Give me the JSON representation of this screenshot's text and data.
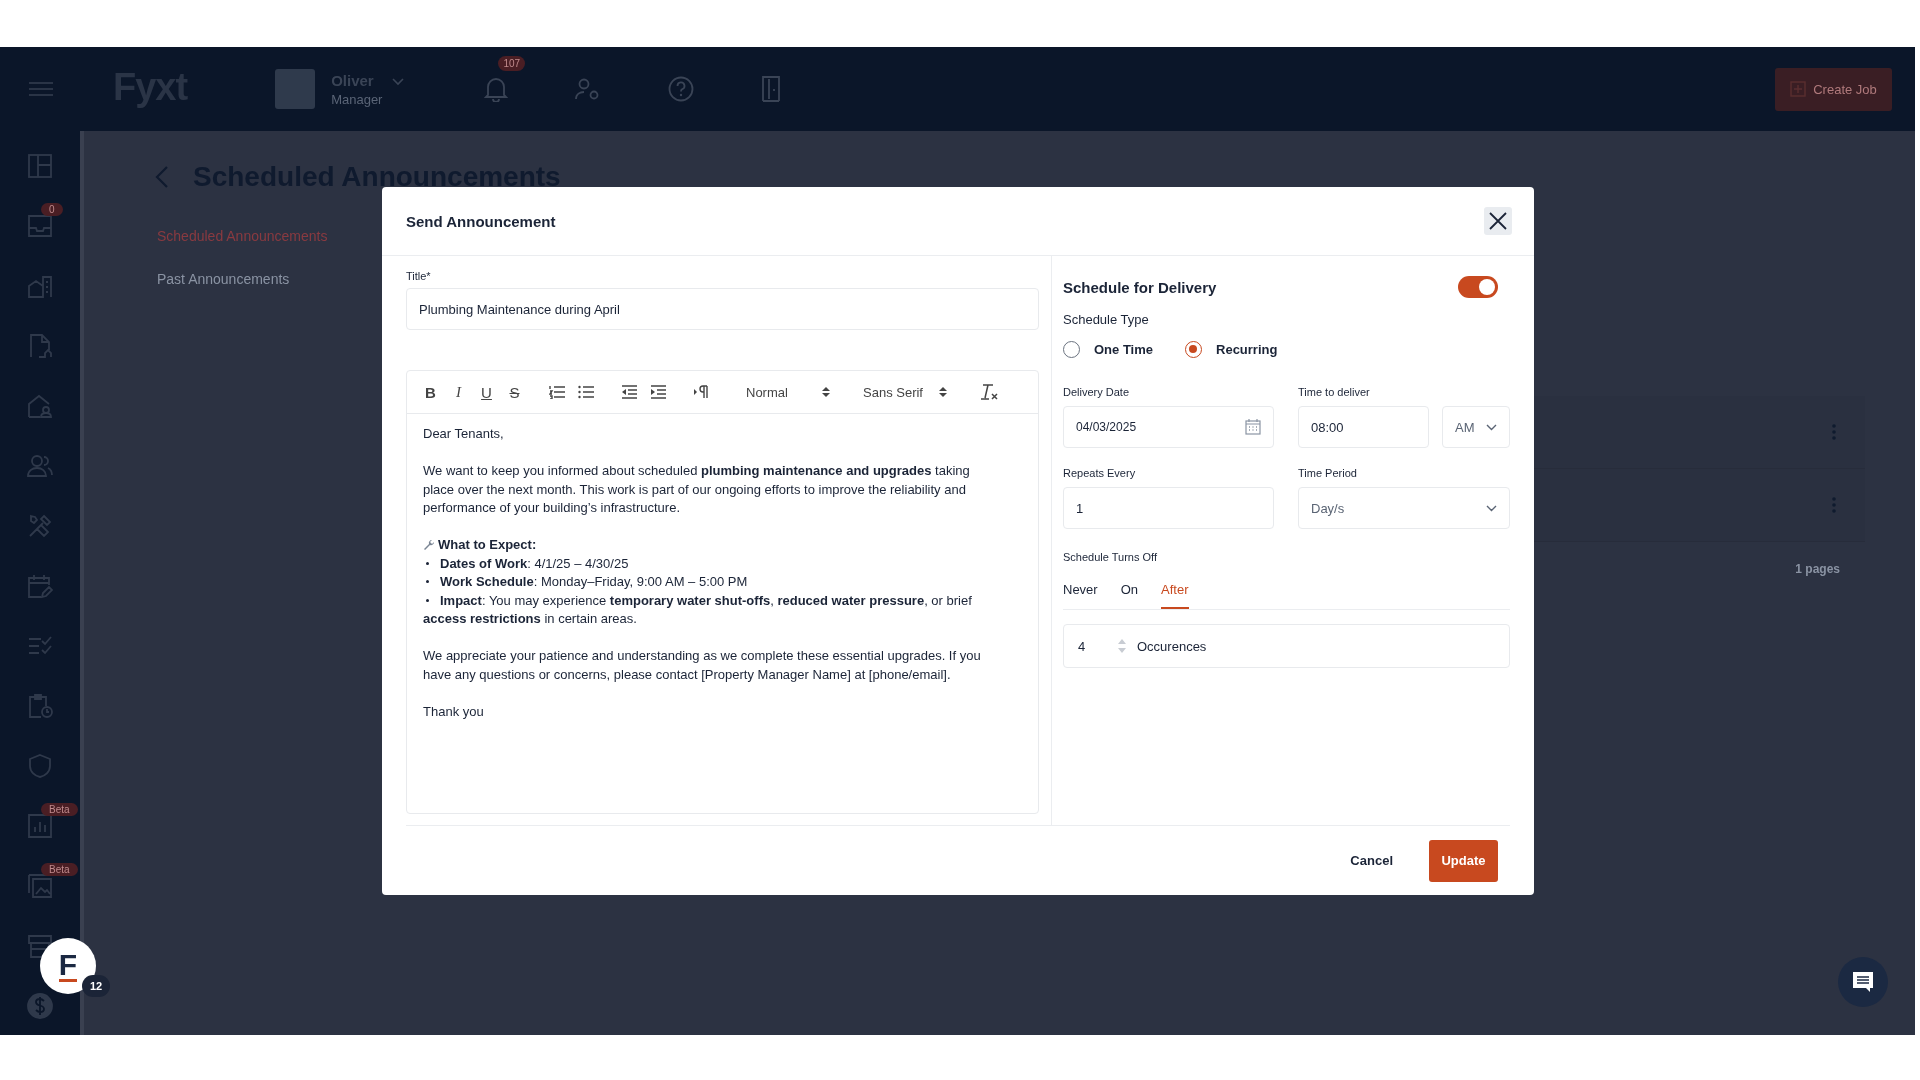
{
  "topbar": {
    "logo": "Fyxt",
    "user": {
      "name": "Oliver",
      "role": "Manager"
    },
    "notifications_badge": "107",
    "create_button": "Create Job"
  },
  "sidebar": {
    "items": [
      {
        "kind": "dashboard"
      },
      {
        "kind": "inbox",
        "badge": "0"
      },
      {
        "kind": "buildings"
      },
      {
        "kind": "document"
      },
      {
        "kind": "house"
      },
      {
        "kind": "people"
      },
      {
        "kind": "tools"
      },
      {
        "kind": "calendar"
      },
      {
        "kind": "checklist"
      },
      {
        "kind": "clipboard"
      },
      {
        "kind": "shield"
      },
      {
        "kind": "chart",
        "badge": "Beta"
      },
      {
        "kind": "gallery",
        "badge": "Beta"
      },
      {
        "kind": "store"
      },
      {
        "kind": "dollar"
      }
    ]
  },
  "assistant": {
    "letter": "F",
    "badge": "12"
  },
  "page": {
    "title": "Scheduled Announcements",
    "nav": [
      {
        "label": "Scheduled Announcements",
        "selected": true
      },
      {
        "label": "Past Announcements",
        "selected": false
      }
    ],
    "pagination": "1 pages"
  },
  "modal": {
    "title": "Send Announcement",
    "title_field": {
      "label": "Title*",
      "value": "Plumbing Maintenance during April"
    },
    "toolbar": [
      {
        "kind": "bold",
        "label": "B"
      },
      {
        "kind": "italic",
        "label": "I"
      },
      {
        "kind": "underline",
        "label": "U"
      },
      {
        "kind": "strike",
        "label": "S"
      },
      {
        "kind": "ordered-list"
      },
      {
        "kind": "bullet-list"
      },
      {
        "kind": "outdent"
      },
      {
        "kind": "indent"
      },
      {
        "kind": "direction"
      },
      {
        "kind": "select",
        "label": "Normal"
      },
      {
        "kind": "select",
        "label": "Sans Serif"
      },
      {
        "kind": "clean"
      }
    ],
    "body": [
      {
        "kind": "p",
        "text": "Dear Tenants,"
      },
      {
        "kind": "p",
        "text": "We want to keep you informed about scheduled **plumbing maintenance and upgrades** taking place over the next month. This work is part of our ongoing efforts to improve the reliability and performance of your building’s infrastructure."
      },
      {
        "kind": "heading",
        "text": "What to Expect:"
      },
      {
        "kind": "bullet",
        "text": "**Dates of Work**: 4/1/25 – 4/30/25"
      },
      {
        "kind": "bullet",
        "text": "**Work Schedule**: Monday–Friday, 9:00 AM – 5:00 PM"
      },
      {
        "kind": "bullet",
        "text": "**Impact**: You may experience **temporary water shut-offs**, **reduced water pressure**, or brief **access restrictions** in certain areas."
      },
      {
        "kind": "p",
        "text": "We appreciate your patience and understanding as we complete these essential upgrades. If you have any questions or concerns, please contact [Property Manager Name] at [phone/email]."
      },
      {
        "kind": "p",
        "text": "Thank you"
      }
    ],
    "schedule": {
      "title": "Schedule for Delivery",
      "enabled": true,
      "type_label": "Schedule Type",
      "types": [
        {
          "label": "One Time",
          "selected": false
        },
        {
          "label": "Recurring",
          "selected": true
        }
      ],
      "delivery_date": {
        "label": "Delivery Date",
        "value": "04/03/2025"
      },
      "time": {
        "label": "Time to deliver",
        "value": "08:00",
        "meridiem": "AM"
      },
      "repeats": {
        "label": "Repeats Every",
        "value": "1"
      },
      "period": {
        "label": "Time Period",
        "value": "Day/s"
      },
      "turns_off": {
        "label": "Schedule Turns Off",
        "tabs": [
          {
            "label": "Never",
            "selected": false
          },
          {
            "label": "On",
            "selected": false
          },
          {
            "label": "After",
            "selected": true
          }
        ],
        "count": "4",
        "unit": "Occurences"
      }
    },
    "buttons": {
      "cancel": "Cancel",
      "update": "Update"
    }
  }
}
